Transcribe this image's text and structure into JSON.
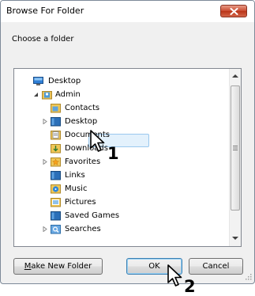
{
  "window": {
    "title": "Browse For Folder",
    "prompt": "Choose a folder"
  },
  "tree": {
    "items": [
      {
        "label": "Desktop",
        "icon": "desktop-icon",
        "level": 0,
        "expander": "none"
      },
      {
        "label": "Admin",
        "icon": "user-folder-icon",
        "level": 1,
        "expander": "expanded"
      },
      {
        "label": "Contacts",
        "icon": "contacts-folder-icon",
        "level": 2,
        "expander": "none"
      },
      {
        "label": "Desktop",
        "icon": "folder-icon",
        "level": 2,
        "expander": "collapsed"
      },
      {
        "label": "Documents",
        "icon": "documents-folder-icon",
        "level": 2,
        "expander": "none",
        "selected": true
      },
      {
        "label": "Downloads",
        "icon": "downloads-folder-icon",
        "level": 2,
        "expander": "none"
      },
      {
        "label": "Favorites",
        "icon": "favorites-folder-icon",
        "level": 2,
        "expander": "collapsed"
      },
      {
        "label": "Links",
        "icon": "links-folder-icon",
        "level": 2,
        "expander": "none"
      },
      {
        "label": "Music",
        "icon": "music-folder-icon",
        "level": 2,
        "expander": "none"
      },
      {
        "label": "Pictures",
        "icon": "pictures-folder-icon",
        "level": 2,
        "expander": "none"
      },
      {
        "label": "Saved Games",
        "icon": "saved-games-folder-icon",
        "level": 2,
        "expander": "none"
      },
      {
        "label": "Searches",
        "icon": "searches-folder-icon",
        "level": 2,
        "expander": "collapsed"
      }
    ]
  },
  "buttons": {
    "make_new_folder_prefix": "M",
    "make_new_folder_rest": "ake New Folder",
    "ok": "OK",
    "cancel": "Cancel"
  },
  "callouts": {
    "first": "1",
    "second": "2"
  },
  "colors": {
    "selection_fill": "#e3f1fc",
    "selection_border": "#9ac8ee",
    "close_button": "#c9492f",
    "default_button_border": "#3c7fb1"
  }
}
